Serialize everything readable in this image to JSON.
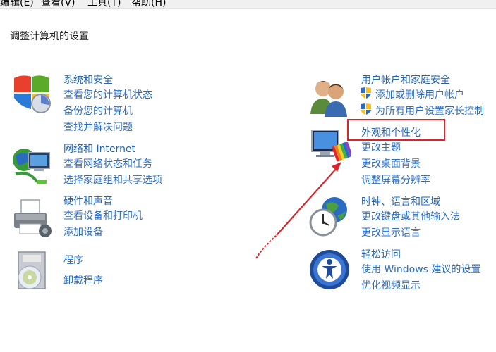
{
  "menubar": {
    "items": [
      "编辑(E)",
      "查看(V)",
      "工具(T)",
      "帮助(H)"
    ]
  },
  "page_title": "调整计算机的设置",
  "categories": {
    "system_security": {
      "title": "系统和安全",
      "links": [
        "查看您的计算机状态",
        "备份您的计算机",
        "查找并解决问题"
      ],
      "icon": "shield-icon"
    },
    "network": {
      "title": "网络和 Internet",
      "links": [
        "查看网络状态和任务",
        "选择家庭组和共享选项"
      ],
      "icon": "network-globe-icon"
    },
    "hardware_sound": {
      "title": "硬件和声音",
      "links": [
        "查看设备和打印机",
        "添加设备"
      ],
      "icon": "printer-icon"
    },
    "programs": {
      "title": "程序",
      "links": [
        "卸载程序"
      ],
      "icon": "programs-disc-icon"
    },
    "user_accounts": {
      "title": "用户帐户和家庭安全",
      "links": [
        "添加或删除用户帐户",
        "为所有用户设置家长控制"
      ],
      "icon": "users-icon"
    },
    "appearance": {
      "title": "外观和个性化",
      "links": [
        "更改主题",
        "更改桌面背景",
        "调整屏幕分辨率"
      ],
      "icon": "monitor-palette-icon"
    },
    "clock_region": {
      "title": "时钟、语言和区域",
      "links": [
        "更改键盘或其他输入法",
        "更改显示语言"
      ],
      "icon": "clock-globe-icon"
    },
    "ease_of_access": {
      "title": "轻松访问",
      "links": [
        "使用 Windows 建议的设置",
        "优化视频显示"
      ],
      "icon": "ease-of-access-icon"
    }
  },
  "annotation": {
    "color": "#d8242a"
  },
  "colors": {
    "link": "#2a6cc1",
    "heading": "#1e64b4"
  }
}
